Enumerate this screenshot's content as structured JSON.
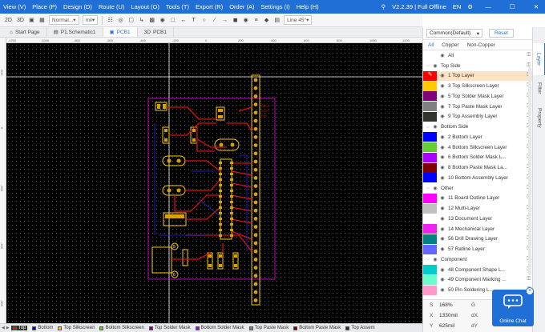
{
  "menu": {
    "items": [
      "View (V)",
      "Place (P)",
      "Design (D)",
      "Route (U)",
      "Layout (O)",
      "Tools (T)",
      "Export (R)",
      "Order (A)",
      "Settings (I)",
      "Help (H)"
    ],
    "version": "V2.2.39 | Full Offline",
    "lang": "EN"
  },
  "toolbar": {
    "view_2d": "2D",
    "view_3d": "3D",
    "mode_value": "Normal...",
    "unit_value": "mil",
    "line_angle": "Line 45°"
  },
  "tabs": [
    {
      "icon": "home-icon",
      "label": "Start Page",
      "active": false
    },
    {
      "icon": "schematic-icon",
      "label": "P1.Schematic1",
      "active": false
    },
    {
      "icon": "pcb-icon",
      "label": "PCB1",
      "active": true
    },
    {
      "icon": "3d-icon",
      "label": "PCB1",
      "active": false
    }
  ],
  "panel": {
    "preset": "Common(Default)",
    "reset": "Reset",
    "filters": [
      "All",
      "Copper",
      "Non-Copper"
    ],
    "active_filter": "All",
    "layers": [
      {
        "type": "row",
        "label": "All",
        "color": "#ffffff"
      },
      {
        "type": "group",
        "label": "Top Side"
      },
      {
        "type": "row",
        "label": "1 Top Layer",
        "color": "#ff0000",
        "active": true
      },
      {
        "type": "row",
        "label": "3 Top Silkscreen Layer",
        "color": "#ffcc00"
      },
      {
        "type": "row",
        "label": "5 Top Solder Mask Layer",
        "color": "#800080"
      },
      {
        "type": "row",
        "label": "7 Top Paste Mask Layer",
        "color": "#808080"
      },
      {
        "type": "row",
        "label": "9 Top Assembly Layer",
        "color": "#33332e"
      },
      {
        "type": "group",
        "label": "Bottom Side"
      },
      {
        "type": "row",
        "label": "2 Bottom Layer",
        "color": "#0000ff"
      },
      {
        "type": "row",
        "label": "4 Bottom Silkscreen Layer",
        "color": "#66cc33"
      },
      {
        "type": "row",
        "label": "6 Bottom Solder Mask L...",
        "color": "#aa00ff"
      },
      {
        "type": "row",
        "label": "8 Bottom Paste Mask La...",
        "color": "#800000"
      },
      {
        "type": "row",
        "label": "10 Bottom Assembly Layer",
        "color": "#0000ff"
      },
      {
        "type": "group",
        "label": "Other"
      },
      {
        "type": "row",
        "label": "11 Board Outline Layer",
        "color": "#ff00ff"
      },
      {
        "type": "row",
        "label": "12 Multi-Layer",
        "color": "#c0c0c0"
      },
      {
        "type": "row",
        "label": "13 Document Layer",
        "color": "#ffffff"
      },
      {
        "type": "row",
        "label": "14 Mechanical Layer",
        "color": "#f022f0"
      },
      {
        "type": "row",
        "label": "56 Drill Drawing Layer",
        "color": "#008080"
      },
      {
        "type": "row",
        "label": "57 Ratline Layer",
        "color": "#6464ff"
      },
      {
        "type": "group",
        "label": "Component"
      },
      {
        "type": "row",
        "label": "48 Component Shape L...",
        "color": "#00cccc"
      },
      {
        "type": "row",
        "label": "49 Component Marking ...",
        "color": "#66ffcc"
      },
      {
        "type": "row",
        "label": "50 Pin Soldering L...",
        "color": "#ff99cc"
      }
    ],
    "status": [
      {
        "k": "S",
        "v": "168%",
        "k2": "G",
        "v2": ""
      },
      {
        "k": "X",
        "v": "1330mil",
        "k2": "dX",
        "v2": ""
      },
      {
        "k": "Y",
        "v": "625mil",
        "k2": "dY",
        "v2": ""
      }
    ]
  },
  "sidetabs": [
    "Layer",
    "Filter",
    "Property"
  ],
  "layerbar": [
    {
      "label": "Top",
      "color": "#ff0000",
      "active": true
    },
    {
      "label": "Bottom",
      "color": "#0000ff"
    },
    {
      "label": "Top Silkscreen",
      "color": "#ffcc00"
    },
    {
      "label": "Bottom Silkscreen",
      "color": "#66cc33"
    },
    {
      "label": "Top Solder Mask",
      "color": "#800080"
    },
    {
      "label": "Bottom Solder Mask",
      "color": "#aa00ff"
    },
    {
      "label": "Top Paste Mask",
      "color": "#808080"
    },
    {
      "label": "Bottom Paste Mask",
      "color": "#800000"
    },
    {
      "label": "Top Assem",
      "color": "#33332e"
    }
  ],
  "ruler_top": [
    "-1200",
    "-1000",
    "-800",
    "-600",
    "-400",
    "-200",
    "0",
    "200",
    "400",
    "600",
    "800",
    "1000",
    "1200"
  ],
  "ruler_left": [
    "200",
    "0",
    "-200",
    "-400",
    "-600"
  ],
  "chat": {
    "label": "Online Chat"
  },
  "board_text": [
    "NEXT",
    "TEXT",
    "PIN",
    "5",
    "6"
  ]
}
